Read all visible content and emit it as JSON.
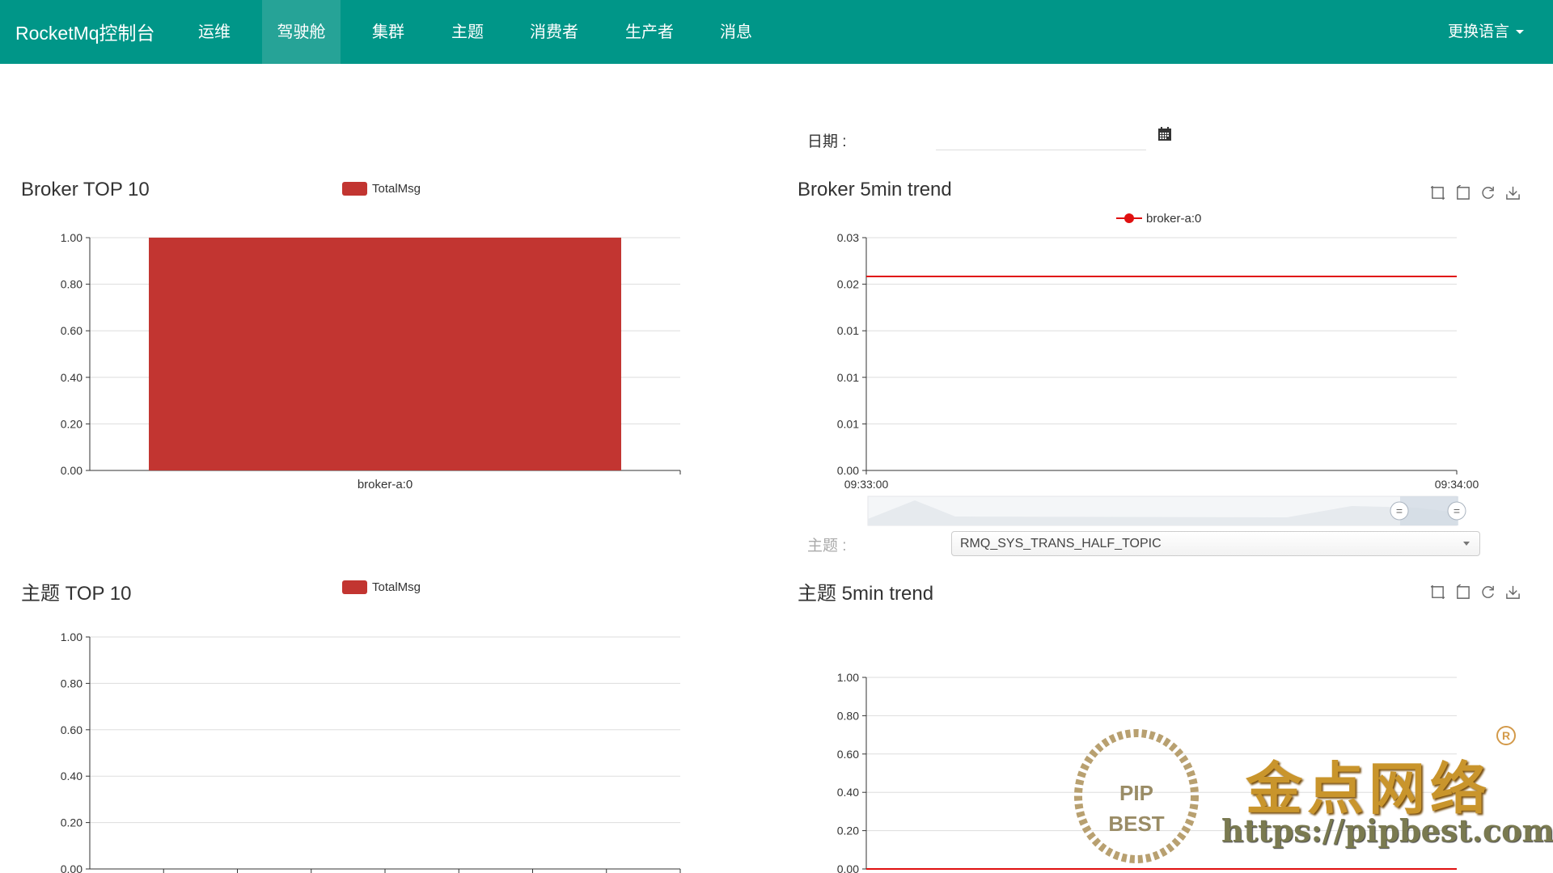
{
  "navbar": {
    "brand": "RocketMq控制台",
    "items": [
      {
        "label": "运维",
        "active": false
      },
      {
        "label": "驾驶舱",
        "active": true
      },
      {
        "label": "集群",
        "active": false
      },
      {
        "label": "主题",
        "active": false
      },
      {
        "label": "消费者",
        "active": false
      },
      {
        "label": "生产者",
        "active": false
      },
      {
        "label": "消息",
        "active": false
      }
    ],
    "language_label": "更换语言"
  },
  "date_filter": {
    "label": "日期 :",
    "value": "",
    "icon": "calendar-icon"
  },
  "topic_filter": {
    "label": "主题 :",
    "selected": "RMQ_SYS_TRANS_HALF_TOPIC"
  },
  "colors": {
    "nav_bg": "#009688",
    "bar": "#c23531",
    "line": "#e01010"
  },
  "charts": {
    "broker_top10": {
      "title": "Broker TOP 10",
      "legend": "TotalMsg"
    },
    "broker_trend": {
      "title": "Broker 5min trend",
      "legend": "broker-a:0"
    },
    "topic_top10": {
      "title": "主题 TOP 10",
      "legend": "TotalMsg"
    },
    "topic_trend": {
      "title": "主题 5min trend"
    }
  },
  "chart_data": [
    {
      "type": "bar",
      "title": "Broker TOP 10",
      "categories": [
        "broker-a:0"
      ],
      "series": [
        {
          "name": "TotalMsg",
          "values": [
            1.0
          ]
        }
      ],
      "ylim": [
        0,
        1.0
      ],
      "yticks": [
        "0.00",
        "0.20",
        "0.40",
        "0.60",
        "0.80",
        "1.00"
      ],
      "grid": true,
      "legend_position": "top"
    },
    {
      "type": "line",
      "title": "Broker 5min trend",
      "x": [
        "09:33:00",
        "09:34:00"
      ],
      "series": [
        {
          "name": "broker-a:0",
          "values": [
            0.025,
            0.025
          ]
        }
      ],
      "ylim": [
        0,
        0.03
      ],
      "yticks": [
        "0.00",
        "0.01",
        "0.01",
        "0.01",
        "0.02",
        "0.03"
      ],
      "grid": true,
      "legend_position": "top"
    },
    {
      "type": "bar",
      "title": "主题 TOP 10",
      "categories": [],
      "series": [
        {
          "name": "TotalMsg",
          "values": []
        }
      ],
      "ylim": [
        0,
        1.0
      ],
      "yticks": [
        "0.00",
        "0.20",
        "0.40",
        "0.60",
        "0.80",
        "1.00"
      ],
      "grid": true,
      "legend_position": "top"
    },
    {
      "type": "line",
      "title": "主题 5min trend",
      "series": [
        {
          "values": [
            0,
            0
          ]
        }
      ],
      "ylim": [
        0,
        1.0
      ],
      "yticks": [
        "0.00",
        "0.20",
        "0.40",
        "0.60",
        "0.80",
        "1.00"
      ],
      "grid": true
    }
  ],
  "toolbox_icons": [
    "zoom-icon",
    "zoom-reset-icon",
    "restore-icon",
    "save-image-icon"
  ],
  "watermark": {
    "text_cn": "金点网络",
    "url": "https://pipbest.com",
    "seal_top": "PIP",
    "seal_bottom": "BEST",
    "registered": "R"
  }
}
